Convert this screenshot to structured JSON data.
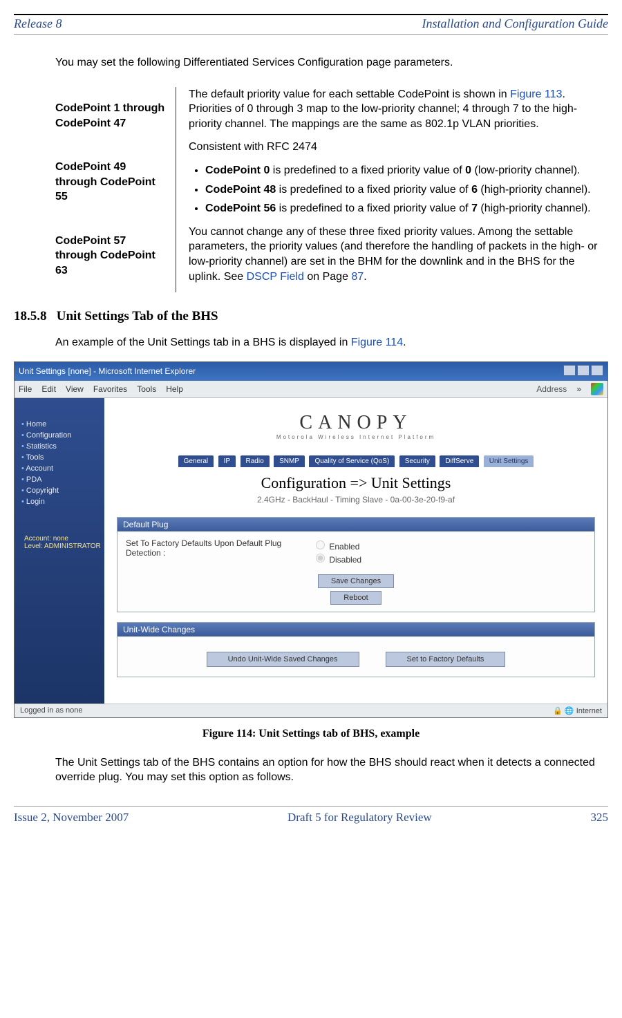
{
  "header": {
    "left": "Release 8",
    "right": "Installation and Configuration Guide"
  },
  "footer": {
    "left": "Issue 2, November 2007",
    "center": "Draft 5 for Regulatory Review",
    "right": "325"
  },
  "intro": "You may set the following Differentiated Services Configuration page parameters.",
  "defs": {
    "left_labels": [
      "CodePoint 1 through CodePoint 47",
      "CodePoint 49 through CodePoint 55",
      "CodePoint 57 through CodePoint 63"
    ],
    "p1_pre": "The default priority value for each settable CodePoint is shown in ",
    "p1_link": "Figure 113",
    "p1_post": ". Priorities of 0 through 3 map to the low-priority channel; 4 through 7 to the high-priority channel. The mappings are the same as 802.1p VLAN priorities.",
    "p2": "Consistent with RFC 2474",
    "b1_strong": "CodePoint 0",
    "b1_mid": " is predefined to a fixed priority value of ",
    "b1_val": "0",
    "b1_tail": " (low-priority channel).",
    "b2_strong": "CodePoint 48",
    "b2_mid": " is predefined to a fixed priority value of ",
    "b2_val": "6",
    "b2_tail": " (high-priority channel).",
    "b3_strong": "CodePoint 56",
    "b3_mid": " is predefined to a fixed priority value of ",
    "b3_val": "7",
    "b3_tail": " (high-priority channel).",
    "p3_pre": "You cannot change any of these three fixed priority values. Among the settable parameters, the priority values (and therefore the handling of packets in the high- or low-priority channel) are set in the BHM for the downlink and in the BHS for the uplink. See ",
    "p3_link": "DSCP Field",
    "p3_mid": " on Page ",
    "p3_link2": "87",
    "p3_post": "."
  },
  "section": {
    "number": "18.5.8",
    "title": "Unit Settings Tab of the BHS",
    "text_pre": "An example of the Unit Settings tab in a BHS is displayed in ",
    "text_link": "Figure 114",
    "text_post": "."
  },
  "browser": {
    "title": "Unit Settings [none] - Microsoft Internet Explorer",
    "menus": [
      "File",
      "Edit",
      "View",
      "Favorites",
      "Tools",
      "Help"
    ],
    "address_label": "Address",
    "sidebar_items": [
      "Home",
      "Configuration",
      "Statistics",
      "Tools",
      "Account",
      "PDA",
      "Copyright",
      "Login"
    ],
    "account_line1": "Account: none",
    "account_line2": "Level: ADMINISTRATOR",
    "logo_main": "CANOPY",
    "logo_sub": "Motorola Wireless Internet Platform",
    "tabs": [
      "General",
      "IP",
      "Radio",
      "SNMP",
      "Quality of Service (QoS)",
      "Security",
      "DiffServe",
      "Unit Settings"
    ],
    "active_tab": "Unit Settings",
    "page_title": "Configuration => Unit Settings",
    "page_sub": "2.4GHz - BackHaul - Timing Slave - 0a-00-3e-20-f9-af",
    "panel1_title": "Default Plug",
    "field_label": "Set To Factory Defaults Upon Default Plug Detection :",
    "radio_enabled": "Enabled",
    "radio_disabled": "Disabled",
    "btn_save": "Save Changes",
    "btn_reboot": "Reboot",
    "panel2_title": "Unit-Wide Changes",
    "btn_undo": "Undo Unit-Wide Saved Changes",
    "btn_factory": "Set to Factory Defaults",
    "status_left": "Logged in as none",
    "status_right": "Internet"
  },
  "figure_caption": "Figure 114: Unit Settings tab of BHS, example",
  "closing": "The Unit Settings tab of the BHS contains an option for how the BHS should react when it detects a connected override plug. You may set this option as follows."
}
